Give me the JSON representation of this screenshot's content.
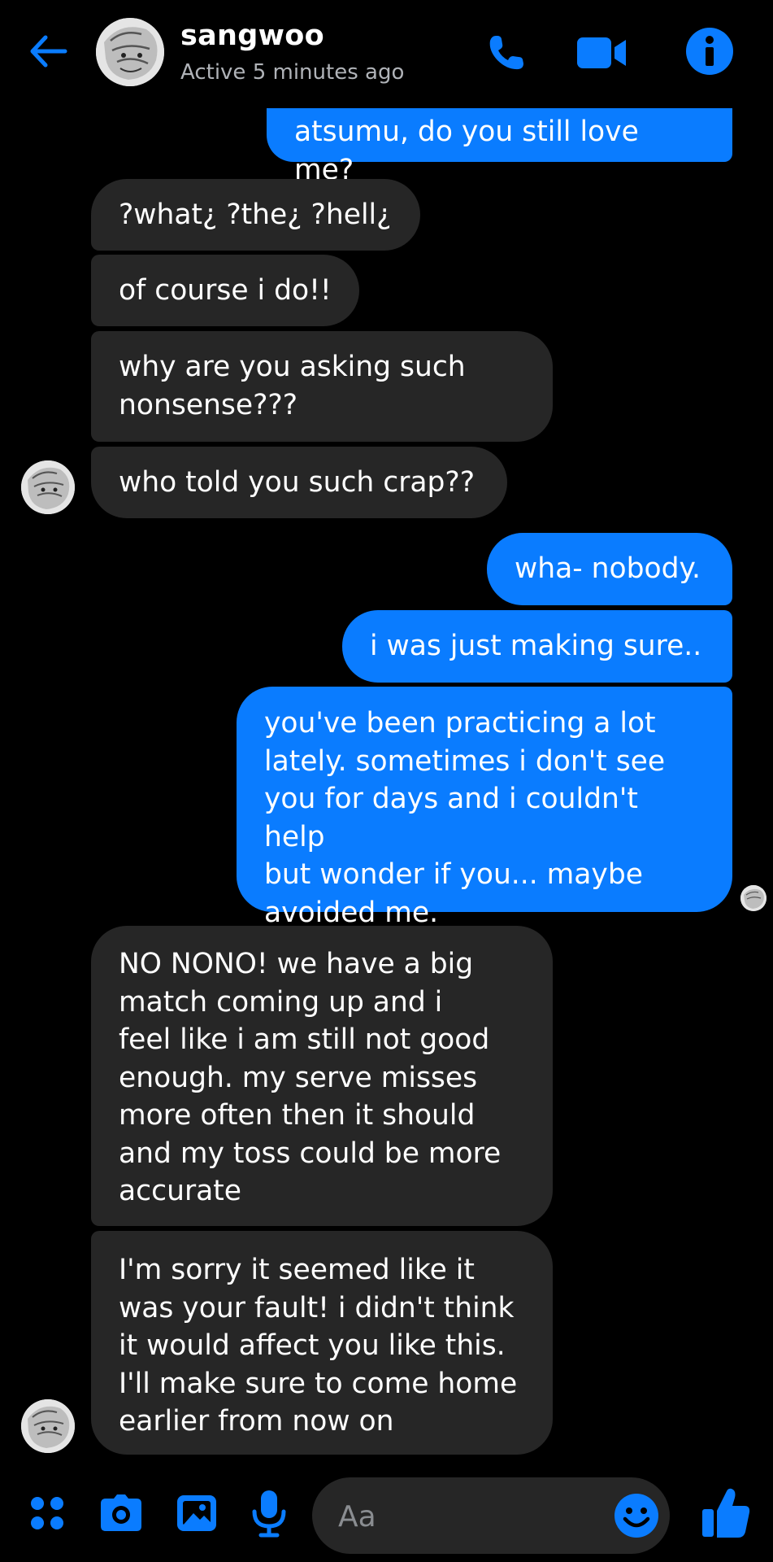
{
  "colors": {
    "accent": "#0a7cff",
    "background": "#000000",
    "incoming_bubble": "#262626",
    "outgoing_bubble": "#0a7cff",
    "status_text": "#b0b3b8"
  },
  "header": {
    "name": "sangwoo",
    "status": "Active 5 minutes ago",
    "icons": [
      "back-arrow-icon",
      "phone-icon",
      "video-camera-icon",
      "info-icon"
    ]
  },
  "messages": [
    {
      "side": "out",
      "text": "atsumu, do you still love me?"
    },
    {
      "side": "in",
      "text": "?what¿ ?the¿ ?hell¿"
    },
    {
      "side": "in",
      "text": "of course i do!!"
    },
    {
      "side": "in",
      "text": "why are you asking such\nnonsense???"
    },
    {
      "side": "in",
      "text": "who told you such crap??"
    },
    {
      "side": "out",
      "text": "wha- nobody."
    },
    {
      "side": "out",
      "text": "i was just making sure.."
    },
    {
      "side": "out",
      "text": "you've been practicing a lot\nlately. sometimes i don't see\nyou for days and i couldn't help\nbut wonder if you... maybe\navoided me."
    },
    {
      "side": "in",
      "text": "NO NONO! we have a big\nmatch coming up and i\nfeel like i am still not good\nenough. my serve misses\nmore often then it should\nand my toss could be more\naccurate"
    },
    {
      "side": "in",
      "text": "I'm sorry it seemed like it\nwas your fault! i didn't think\nit would affect you like this.\nI'll make sure to come home\nearlier from now on"
    }
  ],
  "composer": {
    "placeholder": "Aa",
    "icons": [
      "apps-menu-icon",
      "camera-icon",
      "gallery-icon",
      "microphone-icon",
      "emoji-icon",
      "thumbs-up-icon"
    ]
  }
}
